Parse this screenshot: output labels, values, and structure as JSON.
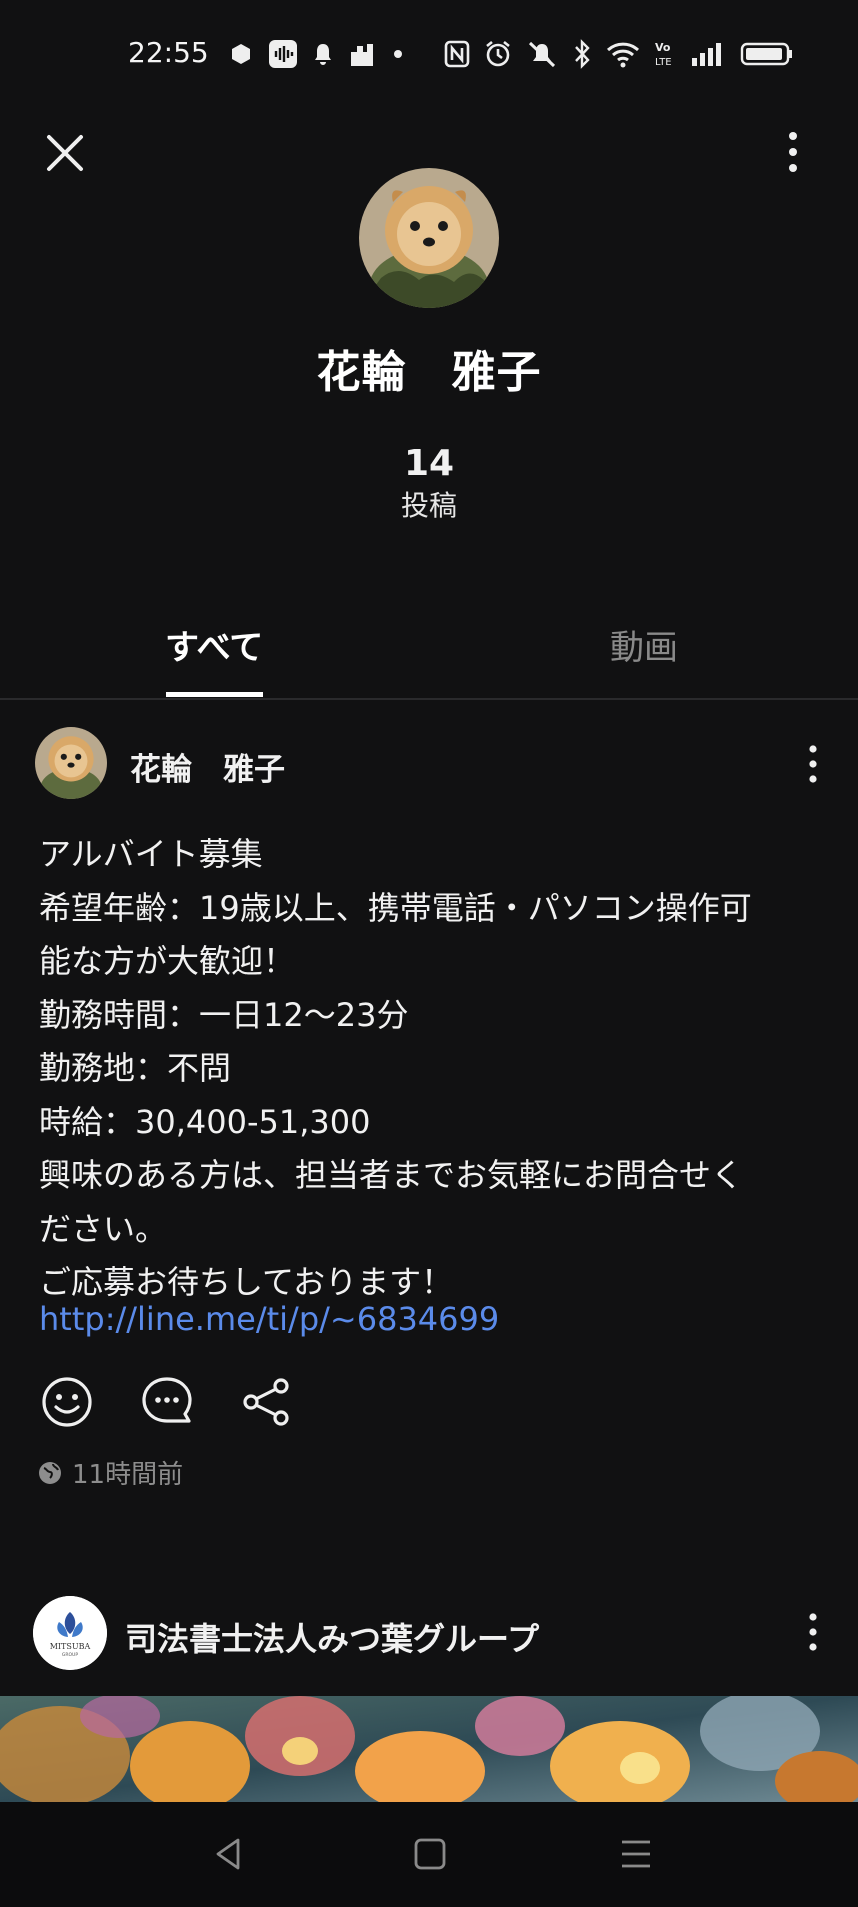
{
  "status_bar": {
    "time": "22:55"
  },
  "profile": {
    "name": "花輪　雅子",
    "post_count": "14",
    "post_count_label": "投稿"
  },
  "tabs": [
    {
      "label": "すべて",
      "selected": true
    },
    {
      "label": "動画",
      "selected": false
    }
  ],
  "post": {
    "author": "花輪　雅子",
    "body": "アルバイト募集\n希望年齢：19歳以上、携帯電話・パソコン操作可\n能な方が大歓迎！\n勤務時間：一日12〜23分\n勤務地：不問\n時給：30,400-51,300\n興味のある方は、担当者までお気軽にお問合せく\nださい。\nご応募お待ちしております！",
    "link": "http://line.me/ti/p/~6834699",
    "timestamp": "11時間前",
    "actions": [
      "smile-icon",
      "comment-icon",
      "share-icon"
    ]
  },
  "next_post": {
    "author": "司法書士法人みつ葉グループ",
    "logo_text": "MITSUBA",
    "logo_subtext": "GROUP"
  },
  "colors": {
    "background": "#111112",
    "link": "#5b8bea",
    "muted": "#8d8d8d"
  }
}
